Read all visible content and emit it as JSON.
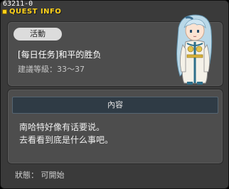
{
  "window": {
    "quest_id": "63211-0",
    "title": "QUEST INFO"
  },
  "quest": {
    "category_badge": "活動",
    "name": "[每日任务]和平的胜负",
    "level_label": "建議等級：33～37"
  },
  "content": {
    "header": "內容",
    "lines": [
      "南哈特好像有话要说。",
      "去看看到底是什么事吧。"
    ]
  },
  "status": {
    "text": "狀態： 可開始"
  },
  "colors": {
    "title_yellow": "#ffd21a",
    "window_bg": "#3a3a3a",
    "panel_bg": "#4d4d4d",
    "header_bg": "#2f3b45",
    "badge_bg": "#dcdcdc",
    "npc_hair": "#b9d8e8",
    "npc_robe": "#f4f1e8",
    "npc_trim": "#2e6f8a"
  },
  "npc": {
    "icon": "npc-portrait-icon"
  }
}
